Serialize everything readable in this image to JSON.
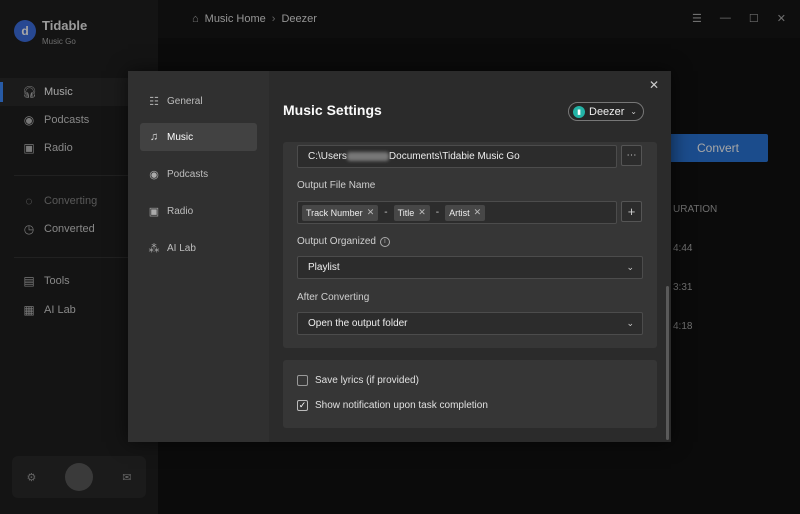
{
  "app": {
    "name": "Tidable",
    "subtitle": "Music Go",
    "logo_glyph": "d"
  },
  "sidebar": {
    "items": [
      {
        "label": "Music",
        "icon": "headphones-icon",
        "active": true
      },
      {
        "label": "Podcasts",
        "icon": "podcast-icon"
      },
      {
        "label": "Radio",
        "icon": "radio-icon"
      },
      {
        "label": "Converting",
        "icon": "converting-icon"
      },
      {
        "label": "Converted",
        "icon": "clock-icon"
      },
      {
        "label": "Tools",
        "icon": "toolbox-icon"
      },
      {
        "label": "AI Lab",
        "icon": "ai-icon"
      }
    ]
  },
  "topbar": {
    "home": "Music Home",
    "current": "Deezer"
  },
  "background": {
    "convert_label": "Convert",
    "duration_header": "URATION",
    "durations": [
      "4:44",
      "3:31",
      "4:18"
    ]
  },
  "modal": {
    "title": "Music Settings",
    "source": "Deezer",
    "nav": [
      {
        "label": "General",
        "icon": "sliders-icon"
      },
      {
        "label": "Music",
        "icon": "music-note-icon",
        "active": true
      },
      {
        "label": "Podcasts",
        "icon": "podcast-icon"
      },
      {
        "label": "Radio",
        "icon": "radio-icon"
      },
      {
        "label": "AI Lab",
        "icon": "ai-icon"
      }
    ],
    "output_path_prefix": "C:\\Users",
    "output_path_suffix": "Documents\\Tidabie Music Go",
    "output_file_name_label": "Output File Name",
    "file_name_tags": [
      "Track Number",
      "Title",
      "Artist"
    ],
    "tag_separator": "-",
    "output_organized_label": "Output Organized",
    "output_organized_value": "Playlist",
    "after_converting_label": "After Converting",
    "after_converting_value": "Open the output folder",
    "save_lyrics_label": "Save lyrics (if provided)",
    "save_lyrics_checked": false,
    "notify_label": "Show notification upon task completion",
    "notify_checked": true
  }
}
